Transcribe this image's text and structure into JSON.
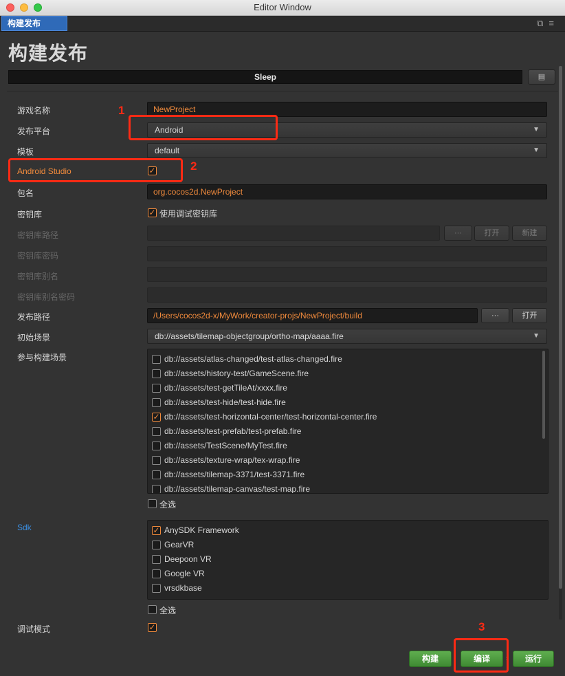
{
  "window": {
    "title": "Editor Window"
  },
  "tab": {
    "label": "构建发布"
  },
  "page": {
    "title": "构建发布",
    "status": "Sleep"
  },
  "form": {
    "game_name": {
      "label": "游戏名称",
      "value": "NewProject"
    },
    "platform": {
      "label": "发布平台",
      "value": "Android"
    },
    "template": {
      "label": "模板",
      "value": "default"
    },
    "android_studio": {
      "label": "Android Studio",
      "checked": true
    },
    "package": {
      "label": "包名",
      "value": "org.cocos2d.NewProject"
    },
    "keystore": {
      "label": "密钥库",
      "option": "使用调试密钥库",
      "checked": true
    },
    "keystore_path": {
      "label": "密钥库路径",
      "browse": "···",
      "open": "打开",
      "new": "新建"
    },
    "keystore_password": {
      "label": "密钥库密码"
    },
    "keystore_alias": {
      "label": "密钥库别名"
    },
    "keystore_alias_password": {
      "label": "密钥库别名密码"
    },
    "build_path": {
      "label": "发布路径",
      "value": "/Users/cocos2d-x/MyWork/creator-projs/NewProject/build",
      "browse": "···",
      "open": "打开"
    },
    "start_scene": {
      "label": "初始场景",
      "value": "db://assets/tilemap-objectgroup/ortho-map/aaaa.fire"
    },
    "scenes": {
      "label": "参与构建场景",
      "items": [
        {
          "text": "db://assets/atlas-changed/test-atlas-changed.fire",
          "checked": false
        },
        {
          "text": "db://assets/history-test/GameScene.fire",
          "checked": false
        },
        {
          "text": "db://assets/test-getTileAt/xxxx.fire",
          "checked": false
        },
        {
          "text": "db://assets/test-hide/test-hide.fire",
          "checked": false
        },
        {
          "text": "db://assets/test-horizontal-center/test-horizontal-center.fire",
          "checked": true
        },
        {
          "text": "db://assets/test-prefab/test-prefab.fire",
          "checked": false
        },
        {
          "text": "db://assets/TestScene/MyTest.fire",
          "checked": false
        },
        {
          "text": "db://assets/texture-wrap/tex-wrap.fire",
          "checked": false
        },
        {
          "text": "db://assets/tilemap-3371/test-3371.fire",
          "checked": false
        },
        {
          "text": "db://assets/tilemap-canvas/test-map.fire",
          "checked": false
        }
      ],
      "select_all": "全选"
    },
    "sdk": {
      "label": "Sdk",
      "items": [
        {
          "text": "AnySDK Framework",
          "checked": true
        },
        {
          "text": "GearVR",
          "checked": false
        },
        {
          "text": "Deepoon VR",
          "checked": false
        },
        {
          "text": "Google VR",
          "checked": false
        },
        {
          "text": "vrsdkbase",
          "checked": false
        }
      ],
      "select_all": "全选"
    },
    "debug": {
      "label": "调试模式",
      "checked": true
    }
  },
  "footer": {
    "build": "构建",
    "compile": "编译",
    "run": "运行"
  },
  "annotations": [
    "1",
    "2",
    "3"
  ],
  "colors": {
    "accent": "#f08a3c",
    "button_green": "#4f9c41",
    "tab_blue": "#2f6ab8",
    "annotation_red": "#ff2a14"
  }
}
